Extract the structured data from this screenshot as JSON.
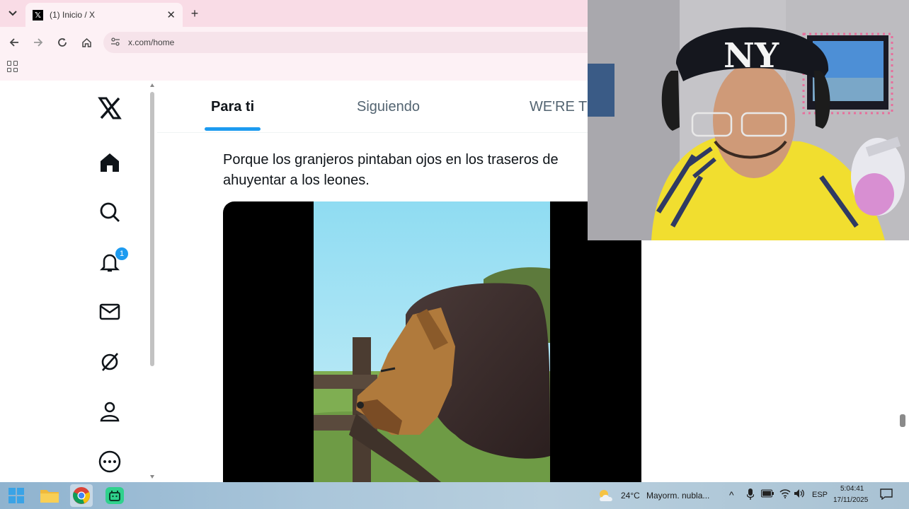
{
  "browser": {
    "tab_title": "(1) Inicio / X",
    "tab_favicon": "x-logo-icon",
    "url": "x.com/home"
  },
  "x_app": {
    "nav_items": [
      {
        "name": "x-logo-icon"
      },
      {
        "name": "home-icon"
      },
      {
        "name": "search-icon"
      },
      {
        "name": "bell-icon",
        "badge": "1"
      },
      {
        "name": "mail-icon"
      },
      {
        "name": "grok-icon"
      },
      {
        "name": "profile-icon"
      },
      {
        "name": "more-icon"
      }
    ],
    "timeline_tabs": [
      "Para ti",
      "Siguiendo",
      "WE'RE T"
    ],
    "active_tab": "Para ti",
    "post_text": "Porque los granjeros pintaban ojos en los traseros de ahuyentar a los leones.",
    "accent_color": "#1d9bf0"
  },
  "taskbar": {
    "weather_temp": "24°C",
    "weather_desc": "Mayorm. nubla...",
    "language": "ESP",
    "time": "5:04:41",
    "date": "17/11/2025"
  }
}
